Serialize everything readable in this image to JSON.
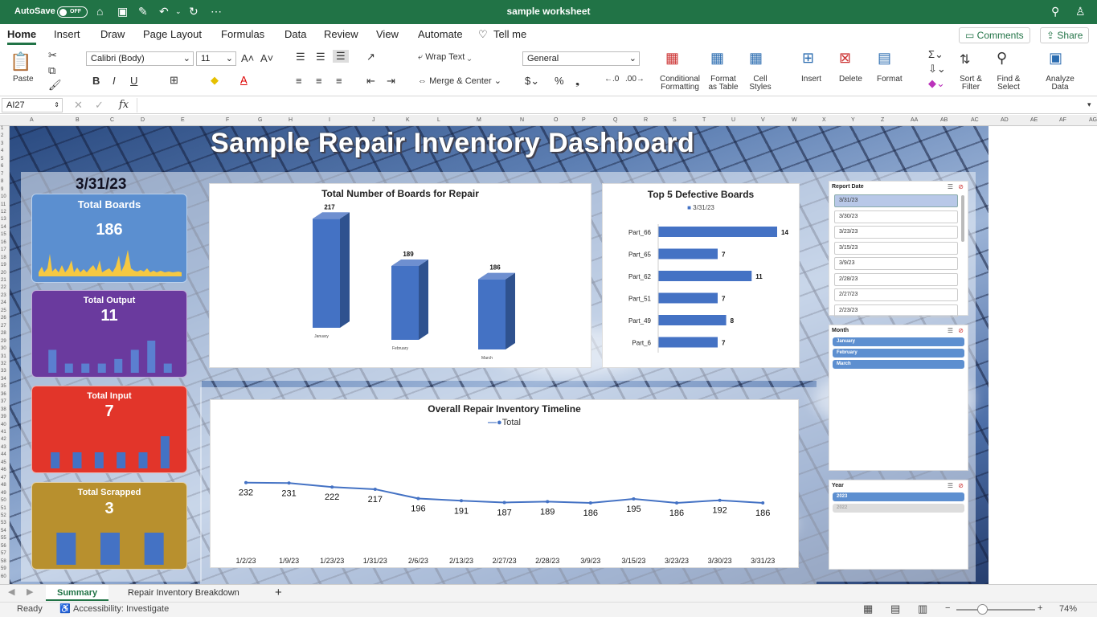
{
  "titlebar": {
    "autosave": "AutoSave",
    "toggle": "OFF",
    "doc_title": "sample worksheet"
  },
  "tabs": [
    "Home",
    "Insert",
    "Draw",
    "Page Layout",
    "Formulas",
    "Data",
    "Review",
    "View",
    "Automate",
    "Tell me"
  ],
  "header_buttons": {
    "comments": "Comments",
    "share": "Share"
  },
  "ribbon": {
    "paste": "Paste",
    "font": "Calibri (Body)",
    "size": "11",
    "wrap": "Wrap Text",
    "merge": "Merge & Center",
    "number_format": "General",
    "cond_fmt": "Conditional Formatting",
    "fmt_table": "Format as Table",
    "cell_styles": "Cell Styles",
    "insert": "Insert",
    "delete": "Delete",
    "format": "Format",
    "sort": "Sort & Filter",
    "find": "Find & Select",
    "analyze": "Analyze Data"
  },
  "formula_bar": {
    "name_box": "AI27",
    "fx": "fx"
  },
  "columns": [
    "A",
    "B",
    "C",
    "D",
    "E",
    "F",
    "G",
    "H",
    "I",
    "J",
    "K",
    "L",
    "M",
    "N",
    "O",
    "P",
    "Q",
    "R",
    "S",
    "T",
    "U",
    "V",
    "W",
    "X",
    "Y",
    "Z",
    "AA",
    "AB",
    "AC",
    "AD",
    "AE",
    "AF",
    "AG"
  ],
  "dashboard": {
    "title": "Sample Repair Inventory Dashboard",
    "date": "3/31/23",
    "kpis": [
      {
        "label": "Total Boards",
        "value": "186",
        "color": "#5b8fd0"
      },
      {
        "label": "Total  Output",
        "value": "11",
        "color": "#6a3a9e"
      },
      {
        "label": "Total Input",
        "value": "7",
        "color": "#e2352a"
      },
      {
        "label": "Total  Scrapped",
        "value": "3",
        "color": "#b8902e"
      }
    ],
    "kpi_sparks": {
      "output": [
        5,
        2,
        2,
        2,
        3,
        5,
        7,
        2
      ],
      "input": [
        2,
        2,
        2,
        2,
        2,
        4
      ],
      "scrapped": [
        3,
        3,
        3
      ]
    }
  },
  "chart_data": [
    {
      "type": "bar",
      "title": "Total Number of Boards for Repair",
      "categories": [
        "January",
        "February",
        "March"
      ],
      "values": [
        217,
        189,
        186
      ]
    },
    {
      "type": "bar",
      "title": "Top 5  Defective Boards",
      "orientation": "horizontal",
      "legend": "3/31/23",
      "categories": [
        "Part_66",
        "Part_65",
        "Part_62",
        "Part_51",
        "Part_49",
        "Part_6"
      ],
      "values": [
        14,
        7,
        11,
        7,
        8,
        7
      ]
    },
    {
      "type": "line",
      "title": "Overall Repair Inventory Timeline",
      "legend": "Total",
      "x": [
        "1/2/23",
        "1/9/23",
        "1/23/23",
        "1/31/23",
        "2/6/23",
        "2/13/23",
        "2/27/23",
        "2/28/23",
        "3/9/23",
        "3/15/23",
        "3/23/23",
        "3/30/23",
        "3/31/23"
      ],
      "values": [
        232,
        231,
        222,
        217,
        196,
        191,
        187,
        189,
        186,
        195,
        186,
        192,
        186
      ]
    }
  ],
  "slicers": {
    "report_date": {
      "title": "Report Date",
      "items": [
        "3/31/23",
        "3/30/23",
        "3/23/23",
        "3/15/23",
        "3/9/23",
        "2/28/23",
        "2/27/23",
        "2/23/23"
      ]
    },
    "month": {
      "title": "Month",
      "items": [
        "January",
        "February",
        "March"
      ]
    },
    "year": {
      "title": "Year",
      "items": [
        "2023",
        "2022"
      ]
    }
  },
  "sheet_tabs": [
    "Summary",
    "Repair Inventory Breakdown"
  ],
  "status": {
    "ready": "Ready",
    "accessibility": "Accessibility: Investigate",
    "zoom": "74%"
  },
  "colors": {
    "excel_green": "#217346",
    "bar_blue": "#4472c4"
  }
}
